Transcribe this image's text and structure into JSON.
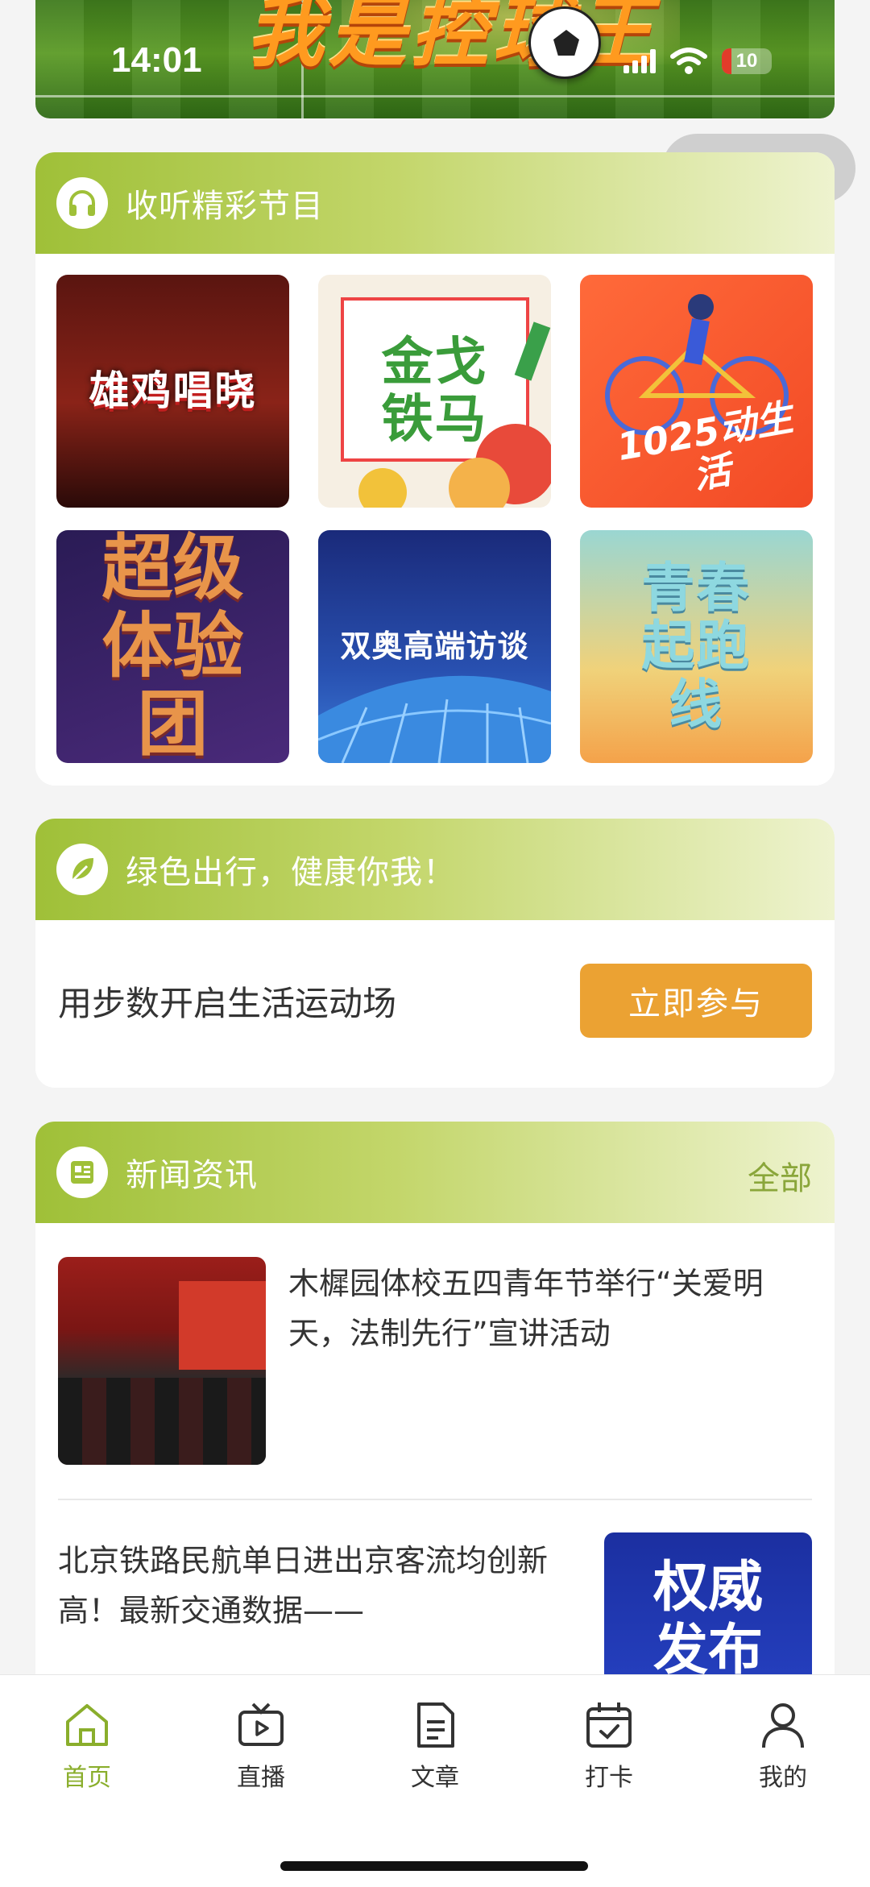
{
  "banner": {
    "title": "我是控球王"
  },
  "status_bar": {
    "time": "14:01",
    "battery": "10"
  },
  "programs": {
    "title": "收听精彩节目",
    "tiles": [
      {
        "label": "雄鸡唱晓"
      },
      {
        "label": "金戈铁马"
      },
      {
        "label": "1025动生活"
      },
      {
        "label": "超级体验团"
      },
      {
        "label": "双奥高端访谈"
      },
      {
        "label": "青春起跑线"
      }
    ]
  },
  "green_travel": {
    "title": "绿色出行，健康你我！",
    "text": "用步数开启生活运动场",
    "button": "立即参与"
  },
  "news": {
    "title": "新闻资讯",
    "more": "全部",
    "items": [
      {
        "title": "木樨园体校五四青年节举行“关爱明天，法制先行”宣讲活动"
      },
      {
        "title": "北京铁路民航单日进出京客流均创新高！最新交通数据——",
        "thumb_text": "权威发布"
      }
    ]
  },
  "tabbar": {
    "items": [
      {
        "label": "首页",
        "icon": "home-icon",
        "active": true
      },
      {
        "label": "直播",
        "icon": "tv-icon"
      },
      {
        "label": "文章",
        "icon": "document-icon"
      },
      {
        "label": "打卡",
        "icon": "calendar-check-icon"
      },
      {
        "label": "我的",
        "icon": "user-icon"
      }
    ]
  },
  "colors": {
    "accent": "#9fc038",
    "button": "#eba233",
    "active_tab": "#8aae2c"
  }
}
